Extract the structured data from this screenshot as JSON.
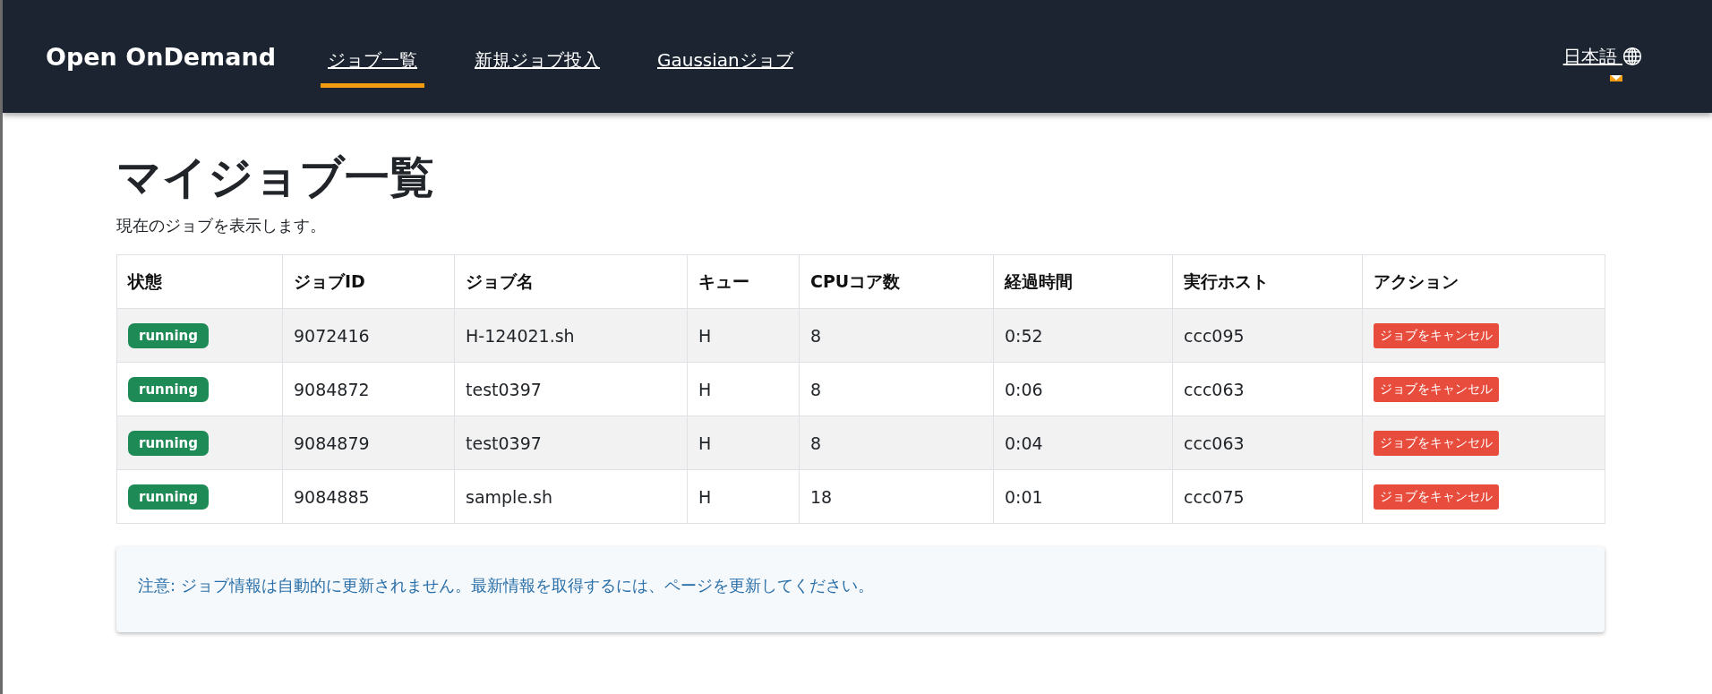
{
  "navbar": {
    "brand": "Open OnDemand",
    "links": [
      {
        "label": "ジョブ一覧",
        "selected": true
      },
      {
        "label": "新規ジョブ投入",
        "selected": false
      },
      {
        "label": "Gaussianジョブ",
        "selected": false
      }
    ],
    "language": {
      "label": "日本語"
    }
  },
  "page": {
    "title": "マイジョブ一覧",
    "subtitle": "現在のジョブを表示します。"
  },
  "table": {
    "columns": [
      "状態",
      "ジョブID",
      "ジョブ名",
      "キュー",
      "CPUコア数",
      "経過時間",
      "実行ホスト",
      "アクション"
    ],
    "rows": [
      {
        "status": "running",
        "job_id": "9072416",
        "name": "H-124021.sh",
        "queue": "H",
        "cpus": "8",
        "elapsed": "0:52",
        "host": "ccc095",
        "action": "ジョブをキャンセル"
      },
      {
        "status": "running",
        "job_id": "9084872",
        "name": "test0397",
        "queue": "H",
        "cpus": "8",
        "elapsed": "0:06",
        "host": "ccc063",
        "action": "ジョブをキャンセル"
      },
      {
        "status": "running",
        "job_id": "9084879",
        "name": "test0397",
        "queue": "H",
        "cpus": "8",
        "elapsed": "0:04",
        "host": "ccc063",
        "action": "ジョブをキャンセル"
      },
      {
        "status": "running",
        "job_id": "9084885",
        "name": "sample.sh",
        "queue": "H",
        "cpus": "18",
        "elapsed": "0:01",
        "host": "ccc075",
        "action": "ジョブをキャンセル"
      }
    ]
  },
  "note": "注意: ジョブ情報は自動的に更新されません。最新情報を取得するには、ページを更新してください。"
}
